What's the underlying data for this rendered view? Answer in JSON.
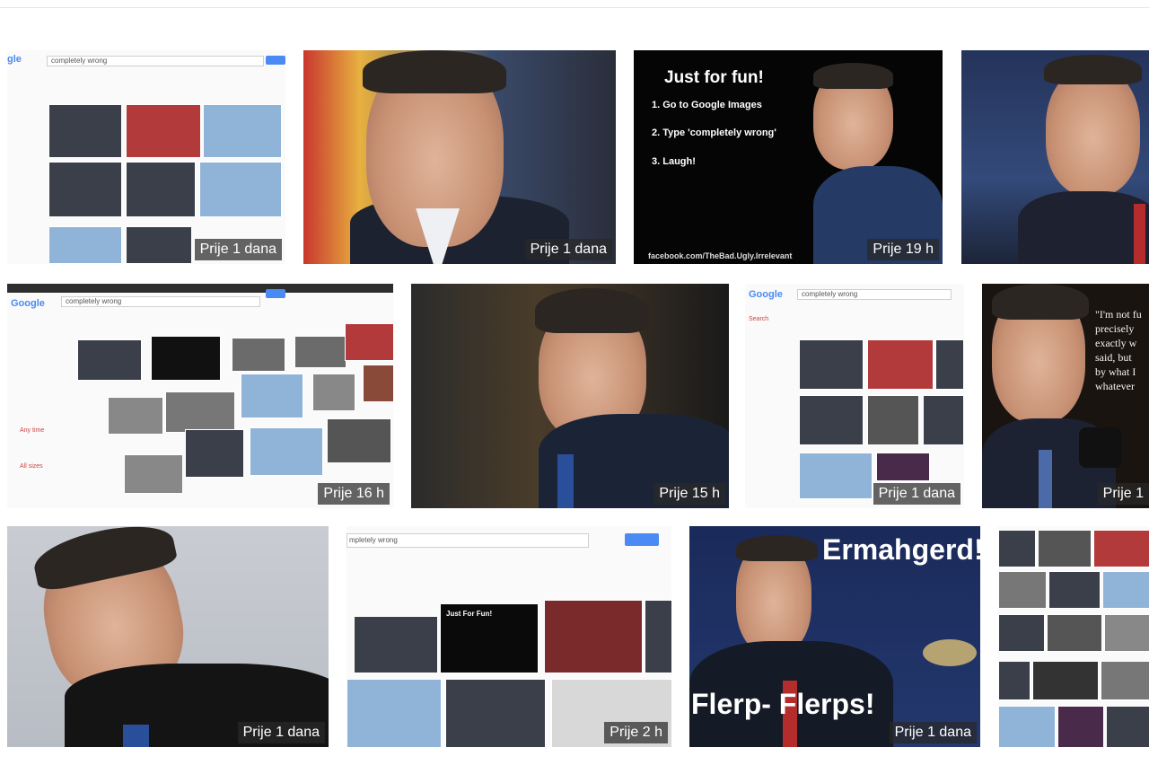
{
  "tiles": [
    {
      "badge": "Prije 1 dana",
      "search_query": "completely wrong",
      "logo": "gle"
    },
    {
      "badge": "Prije 1 dana"
    },
    {
      "badge": "Prije 19 h",
      "meme_title": "Just for fun!",
      "meme_lines": [
        "1. Go to Google Images",
        "2. Type 'completely wrong'",
        "3. Laugh!"
      ],
      "footer": "facebook.com/TheBad.Ugly.Irrelevant"
    },
    {
      "badge": ""
    },
    {
      "badge": "Prije 16 h",
      "search_query": "completely wrong",
      "logo": "Google"
    },
    {
      "badge": "Prije 15 h"
    },
    {
      "badge": "Prije 1 dana",
      "search_query": "completely wrong",
      "logo": "Google"
    },
    {
      "badge": "Prije 1",
      "quote_lines": [
        "\"I'm not fu",
        "precisely",
        "exactly w",
        "said, but",
        "by what I",
        "whatever"
      ]
    },
    {
      "badge": "Prije 1 dana"
    },
    {
      "badge": "Prije 2 h",
      "search_query": "mpletely wrong",
      "mini_meme": "Just For Fun!"
    },
    {
      "badge": "Prije 1 dana",
      "meme_top": "Ermahgerd!",
      "meme_bottom": "Flerp- Flerps!"
    },
    {
      "badge": ""
    }
  ],
  "colors": {
    "accent": "#4a8af4",
    "badge_bg": "#282828"
  }
}
